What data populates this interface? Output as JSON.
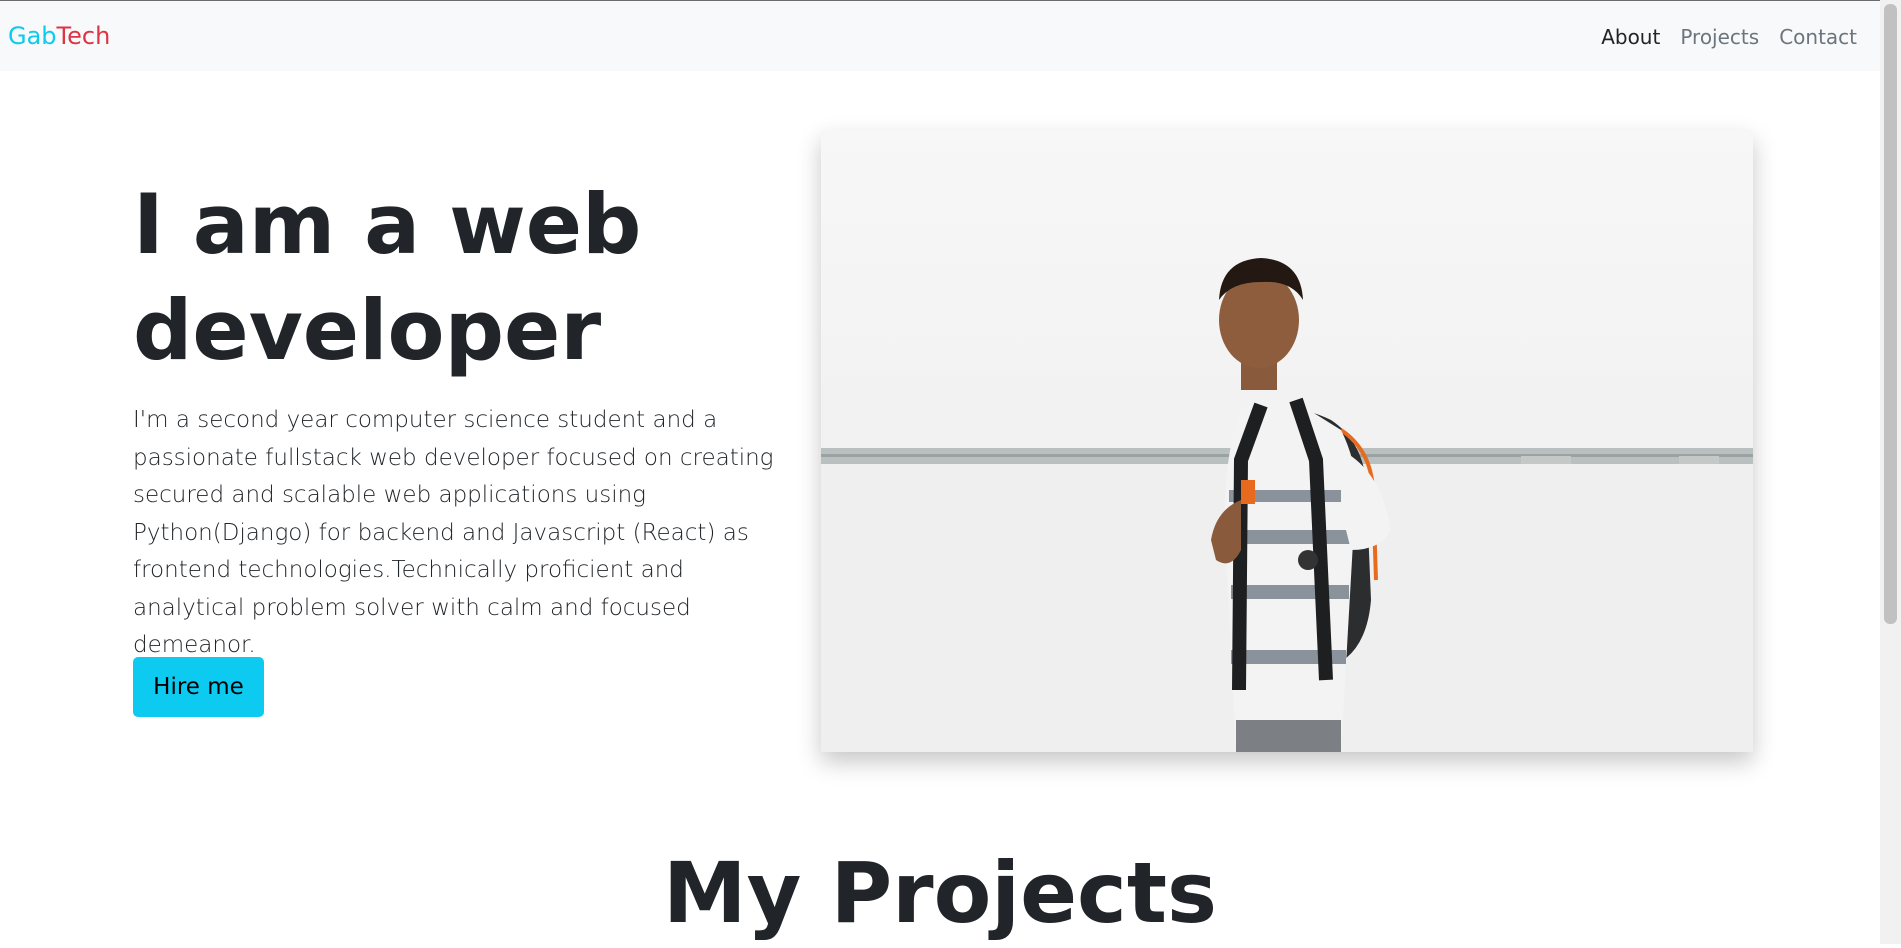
{
  "navbar": {
    "brand_part1": "Gab",
    "brand_part2": "Tech",
    "links": [
      "About",
      "Projects",
      "Contact"
    ],
    "active": "About"
  },
  "hero": {
    "title": "I am a web developer",
    "description": "I'm a second year computer science student and a passionate fullstack web developer focused on creating secured and scalable web applications using Python(Django) for backend and Javascript (React) as frontend technologies.Technically proficient and analytical problem solver with calm and focused demeanor.",
    "button_label": "Hire me",
    "image_icon": "portrait-photo"
  },
  "projects": {
    "title": "My Projects"
  },
  "colors": {
    "brand_primary": "#0dcaf0",
    "brand_secondary": "#dc3545",
    "navbar_bg": "#f8f9fa",
    "text_dark": "#212529",
    "nav_muted": "#6c757d"
  }
}
